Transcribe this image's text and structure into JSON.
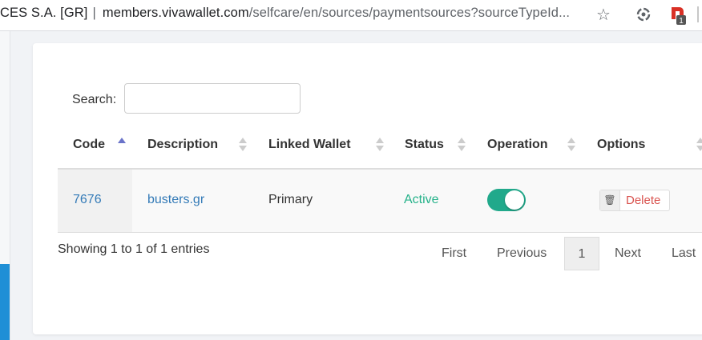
{
  "browser": {
    "title_prefix": "CES S.A. [GR]",
    "separator": "|",
    "url_host": "members.vivawallet.com",
    "url_path": "/selfcare/en/sources/paymentsources?sourceTypeId...",
    "star_glyph": "☆",
    "ext_badge": "1"
  },
  "search": {
    "label": "Search:",
    "value": "",
    "placeholder": ""
  },
  "table": {
    "columns": [
      "Code",
      "Description",
      "Linked Wallet",
      "Status",
      "Operation",
      "Options"
    ],
    "rows": [
      {
        "code": "7676",
        "description": "busters.gr",
        "linked_wallet": "Primary",
        "status": "Active",
        "operation_enabled": true,
        "option_label": "Delete"
      }
    ]
  },
  "info": "Showing 1 to 1 of 1 entries",
  "pagination": {
    "first": "First",
    "previous": "Previous",
    "current": "1",
    "next": "Next",
    "last": "Last"
  },
  "colors": {
    "accent_green": "#26b28a",
    "toggle_on": "#21a98b",
    "link": "#337ab7",
    "delete": "#d9534f",
    "sidebar_accent": "#1f8fd6"
  }
}
